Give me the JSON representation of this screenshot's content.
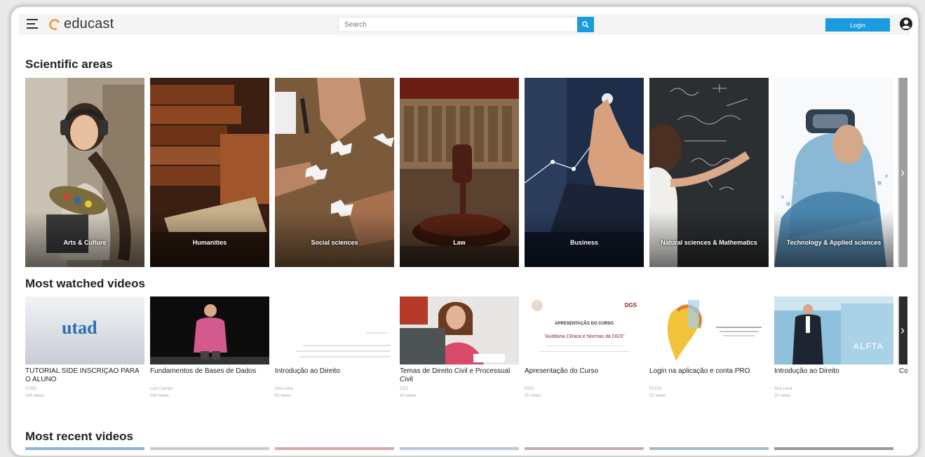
{
  "header": {
    "logo_text": "educast",
    "search_placeholder": "Search",
    "login_label": "Login"
  },
  "sections": {
    "scientific_areas": "Scientific areas",
    "most_watched": "Most watched videos",
    "most_recent": "Most recent videos"
  },
  "areas": [
    {
      "label": "Arts & Culture"
    },
    {
      "label": "Humanities"
    },
    {
      "label": "Social sciences"
    },
    {
      "label": "Law"
    },
    {
      "label": "Business"
    },
    {
      "label": "Natural sciences & Mathematics"
    },
    {
      "label": "Technology & Applied sciences"
    }
  ],
  "videos": [
    {
      "title": "TUTORIAL SIDE INSCRIÇÃO PARA O ALUNO",
      "author": "UTAD",
      "views": "194 views",
      "thumb_text": "utad"
    },
    {
      "title": "Fundamentos de Bases de Dados",
      "author": "Luís Carriço",
      "views": "180 views"
    },
    {
      "title": "Introdução ao Direito",
      "author": "Ana Lima",
      "views": "61 views"
    },
    {
      "title": "Temas de Direito Civil e Processual Civil",
      "author": "CEJ",
      "views": "30 views"
    },
    {
      "title": "Apresentação do Curso",
      "author": "DGS",
      "views": "25 views",
      "thumb_brand": "DGS",
      "thumb_heading": "APRESENTAÇÃO DO CURSO",
      "thumb_subheading": "\"Auditoria Clínica e Normas da DGS\""
    },
    {
      "title": "Login na aplicação e conta PRO",
      "author": "FCCN",
      "views": "22 views"
    },
    {
      "title": "Introdução ao Direito",
      "author": "Ana Lima",
      "views": "20 views",
      "thumb_text": "ALFTA"
    },
    {
      "title": "Coc",
      "author": "",
      "views": ""
    }
  ],
  "colors": {
    "accent": "#1a9be0",
    "logo": "#f0a04b"
  }
}
